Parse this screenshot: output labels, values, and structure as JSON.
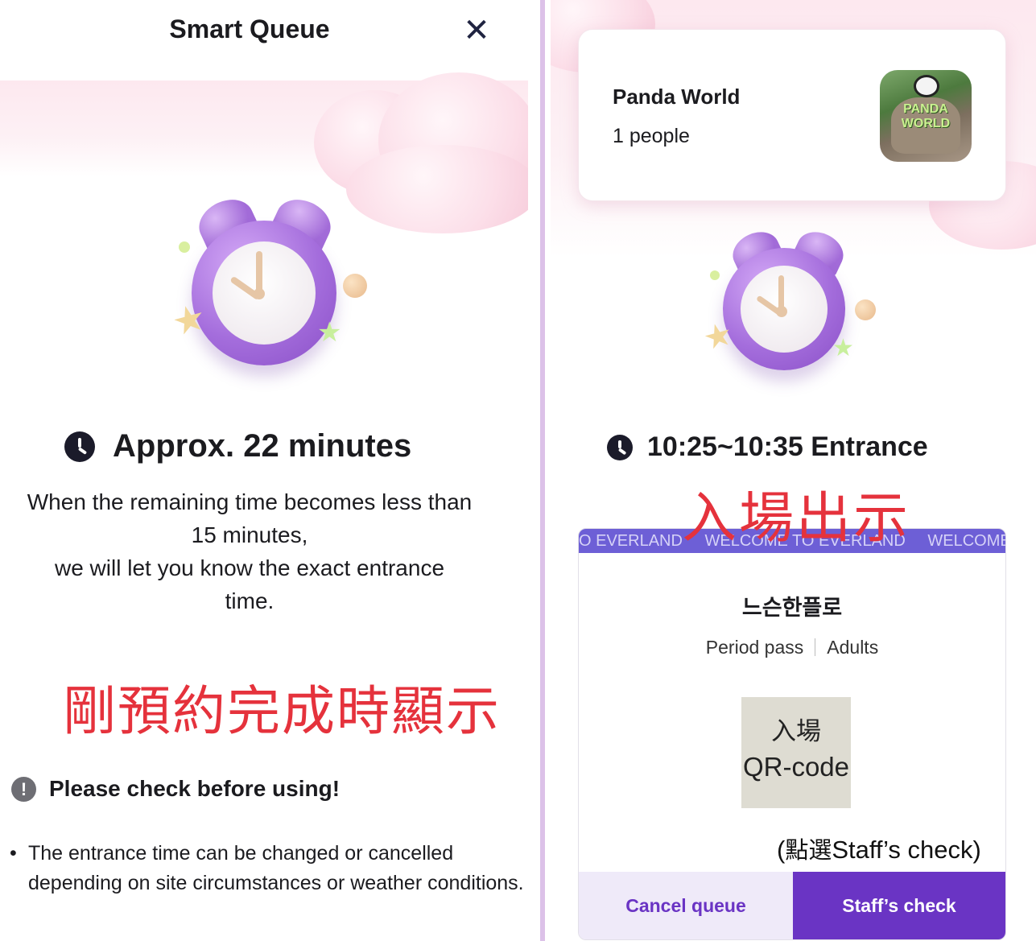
{
  "left_screen": {
    "header": {
      "title": "Smart Queue",
      "close_icon": "close-icon"
    },
    "wait": {
      "icon": "clock-icon",
      "estimate": "Approx. 22 minutes",
      "description_line1": "When the remaining time becomes less than",
      "description_line2": "15 minutes,",
      "description_line3": "we will let you know the exact entrance",
      "description_line4": "time."
    },
    "annotation": "剛預約完成時顯示",
    "notice": {
      "icon": "exclamation-icon",
      "title": "Please check before using!",
      "bullet": "The entrance time can be changed or cancelled depending on site circumstances or weather conditions."
    }
  },
  "right_screen": {
    "attraction": {
      "name": "Panda World",
      "people": "1 people",
      "thumbnail_text": "PANDA WORLD"
    },
    "entrance": {
      "icon": "clock-icon",
      "time": "10:25~10:35 Entrance"
    },
    "annotation": "入場出示",
    "ticket": {
      "marquee": [
        "O EVERLAND",
        "WELCOME TO EVERLAND",
        "WELCOME TO E"
      ],
      "holder": "느슨한플로",
      "pass_type": "Period pass",
      "audience": "Adults",
      "qr_line1": "入場",
      "qr_line2": "QR-code",
      "staff_hint_open": "(",
      "staff_hint_cn": "點選",
      "staff_hint_en": "Staff’s check)",
      "cancel_label": "Cancel queue",
      "staff_label": "Staff’s check"
    }
  },
  "colors": {
    "accent": "#6a34c4",
    "annotation_red": "#e5323c",
    "divider": "#dcc1e8"
  }
}
